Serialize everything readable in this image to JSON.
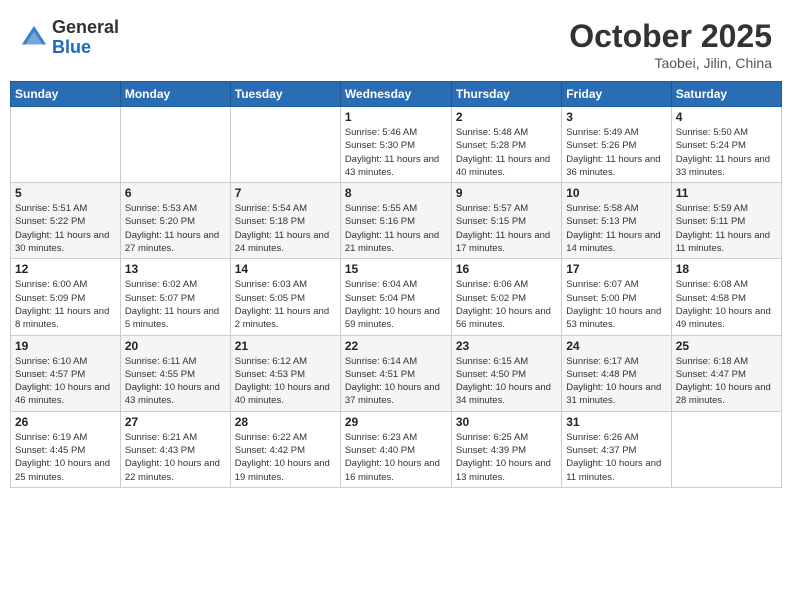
{
  "header": {
    "logo_general": "General",
    "logo_blue": "Blue",
    "month_title": "October 2025",
    "location": "Taobei, Jilin, China"
  },
  "days_of_week": [
    "Sunday",
    "Monday",
    "Tuesday",
    "Wednesday",
    "Thursday",
    "Friday",
    "Saturday"
  ],
  "weeks": [
    {
      "days": [
        {
          "num": "",
          "detail": ""
        },
        {
          "num": "",
          "detail": ""
        },
        {
          "num": "",
          "detail": ""
        },
        {
          "num": "1",
          "detail": "Sunrise: 5:46 AM\nSunset: 5:30 PM\nDaylight: 11 hours\nand 43 minutes."
        },
        {
          "num": "2",
          "detail": "Sunrise: 5:48 AM\nSunset: 5:28 PM\nDaylight: 11 hours\nand 40 minutes."
        },
        {
          "num": "3",
          "detail": "Sunrise: 5:49 AM\nSunset: 5:26 PM\nDaylight: 11 hours\nand 36 minutes."
        },
        {
          "num": "4",
          "detail": "Sunrise: 5:50 AM\nSunset: 5:24 PM\nDaylight: 11 hours\nand 33 minutes."
        }
      ]
    },
    {
      "days": [
        {
          "num": "5",
          "detail": "Sunrise: 5:51 AM\nSunset: 5:22 PM\nDaylight: 11 hours\nand 30 minutes."
        },
        {
          "num": "6",
          "detail": "Sunrise: 5:53 AM\nSunset: 5:20 PM\nDaylight: 11 hours\nand 27 minutes."
        },
        {
          "num": "7",
          "detail": "Sunrise: 5:54 AM\nSunset: 5:18 PM\nDaylight: 11 hours\nand 24 minutes."
        },
        {
          "num": "8",
          "detail": "Sunrise: 5:55 AM\nSunset: 5:16 PM\nDaylight: 11 hours\nand 21 minutes."
        },
        {
          "num": "9",
          "detail": "Sunrise: 5:57 AM\nSunset: 5:15 PM\nDaylight: 11 hours\nand 17 minutes."
        },
        {
          "num": "10",
          "detail": "Sunrise: 5:58 AM\nSunset: 5:13 PM\nDaylight: 11 hours\nand 14 minutes."
        },
        {
          "num": "11",
          "detail": "Sunrise: 5:59 AM\nSunset: 5:11 PM\nDaylight: 11 hours\nand 11 minutes."
        }
      ]
    },
    {
      "days": [
        {
          "num": "12",
          "detail": "Sunrise: 6:00 AM\nSunset: 5:09 PM\nDaylight: 11 hours\nand 8 minutes."
        },
        {
          "num": "13",
          "detail": "Sunrise: 6:02 AM\nSunset: 5:07 PM\nDaylight: 11 hours\nand 5 minutes."
        },
        {
          "num": "14",
          "detail": "Sunrise: 6:03 AM\nSunset: 5:05 PM\nDaylight: 11 hours\nand 2 minutes."
        },
        {
          "num": "15",
          "detail": "Sunrise: 6:04 AM\nSunset: 5:04 PM\nDaylight: 10 hours\nand 59 minutes."
        },
        {
          "num": "16",
          "detail": "Sunrise: 6:06 AM\nSunset: 5:02 PM\nDaylight: 10 hours\nand 56 minutes."
        },
        {
          "num": "17",
          "detail": "Sunrise: 6:07 AM\nSunset: 5:00 PM\nDaylight: 10 hours\nand 53 minutes."
        },
        {
          "num": "18",
          "detail": "Sunrise: 6:08 AM\nSunset: 4:58 PM\nDaylight: 10 hours\nand 49 minutes."
        }
      ]
    },
    {
      "days": [
        {
          "num": "19",
          "detail": "Sunrise: 6:10 AM\nSunset: 4:57 PM\nDaylight: 10 hours\nand 46 minutes."
        },
        {
          "num": "20",
          "detail": "Sunrise: 6:11 AM\nSunset: 4:55 PM\nDaylight: 10 hours\nand 43 minutes."
        },
        {
          "num": "21",
          "detail": "Sunrise: 6:12 AM\nSunset: 4:53 PM\nDaylight: 10 hours\nand 40 minutes."
        },
        {
          "num": "22",
          "detail": "Sunrise: 6:14 AM\nSunset: 4:51 PM\nDaylight: 10 hours\nand 37 minutes."
        },
        {
          "num": "23",
          "detail": "Sunrise: 6:15 AM\nSunset: 4:50 PM\nDaylight: 10 hours\nand 34 minutes."
        },
        {
          "num": "24",
          "detail": "Sunrise: 6:17 AM\nSunset: 4:48 PM\nDaylight: 10 hours\nand 31 minutes."
        },
        {
          "num": "25",
          "detail": "Sunrise: 6:18 AM\nSunset: 4:47 PM\nDaylight: 10 hours\nand 28 minutes."
        }
      ]
    },
    {
      "days": [
        {
          "num": "26",
          "detail": "Sunrise: 6:19 AM\nSunset: 4:45 PM\nDaylight: 10 hours\nand 25 minutes."
        },
        {
          "num": "27",
          "detail": "Sunrise: 6:21 AM\nSunset: 4:43 PM\nDaylight: 10 hours\nand 22 minutes."
        },
        {
          "num": "28",
          "detail": "Sunrise: 6:22 AM\nSunset: 4:42 PM\nDaylight: 10 hours\nand 19 minutes."
        },
        {
          "num": "29",
          "detail": "Sunrise: 6:23 AM\nSunset: 4:40 PM\nDaylight: 10 hours\nand 16 minutes."
        },
        {
          "num": "30",
          "detail": "Sunrise: 6:25 AM\nSunset: 4:39 PM\nDaylight: 10 hours\nand 13 minutes."
        },
        {
          "num": "31",
          "detail": "Sunrise: 6:26 AM\nSunset: 4:37 PM\nDaylight: 10 hours\nand 11 minutes."
        },
        {
          "num": "",
          "detail": ""
        }
      ]
    }
  ]
}
